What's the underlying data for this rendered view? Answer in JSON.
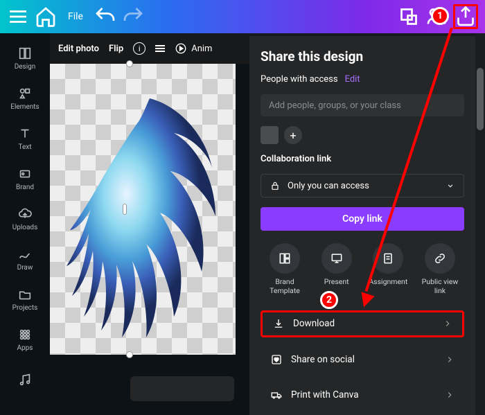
{
  "topbar": {
    "file": "File"
  },
  "sidebar": {
    "items": [
      {
        "label": "Design"
      },
      {
        "label": "Elements"
      },
      {
        "label": "Text"
      },
      {
        "label": "Brand"
      },
      {
        "label": "Uploads"
      },
      {
        "label": "Draw"
      },
      {
        "label": "Projects"
      },
      {
        "label": "Apps"
      }
    ]
  },
  "toolbar": {
    "edit_photo": "Edit photo",
    "flip": "Flip",
    "animate": "Anim"
  },
  "panel": {
    "title": "Share this design",
    "access_label": "People with access",
    "edit": "Edit",
    "input_placeholder": "Add people, groups, or your class",
    "collab_label": "Collaboration link",
    "access_option": "Only you can access",
    "copy": "Copy link",
    "tiles": [
      {
        "label": "Brand Template"
      },
      {
        "label": "Present"
      },
      {
        "label": "Assignment"
      },
      {
        "label": "Public view link"
      }
    ],
    "menu": {
      "download": "Download",
      "social": "Share on social",
      "print": "Print with Canva"
    }
  },
  "annotations": {
    "step1": "1",
    "step2": "2"
  }
}
